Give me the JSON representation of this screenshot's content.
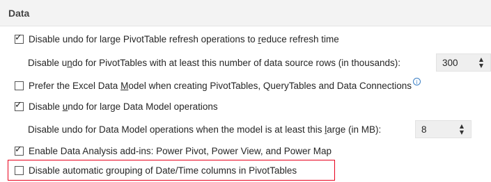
{
  "section": {
    "title": "Data"
  },
  "options": [
    {
      "checked": "✓",
      "text_before": "Disable undo for large PivotTable refresh operations to ",
      "accel": "r",
      "text_after": "educe refresh time"
    },
    {
      "text_before": "Disable u",
      "accel": "n",
      "text_after": "do for PivotTables with at least this number of data source rows (in thousands):",
      "spinner_value": "300"
    },
    {
      "checked": "",
      "text_before": "Prefer the Excel Data ",
      "accel": "M",
      "text_after": "odel when creating PivotTables, QueryTables and Data Connections",
      "info_glyph": "i"
    },
    {
      "checked": "✓",
      "text_before": "Disable ",
      "accel": "u",
      "text_after": "ndo for large Data Model operations"
    },
    {
      "text_before": "Disable undo for Data Model operations when the model is at least this ",
      "accel": "l",
      "text_after": "arge (in MB):",
      "spinner_value": "8"
    },
    {
      "checked": "✓",
      "text_before": "Enable Data Analysis add-ins: Power Pivot, Power View, and Power Map",
      "accel": "",
      "text_after": ""
    },
    {
      "checked": "",
      "text_before": "Disable automatic grouping of Date/Time columns in PivotTables",
      "accel": "",
      "text_after": "",
      "highlighted": true
    }
  ],
  "spinner_arrows": {
    "up": "▲",
    "down": "▼"
  },
  "icons": {
    "checkbox_check": "checkmark-icon",
    "spin_up": "spin-up-icon",
    "spin_down": "spin-down-icon",
    "info": "info-icon"
  },
  "colors": {
    "highlight_border": "#e8001c",
    "info_icon": "#3b7fc4",
    "header_bg": "#f3f3f3"
  }
}
